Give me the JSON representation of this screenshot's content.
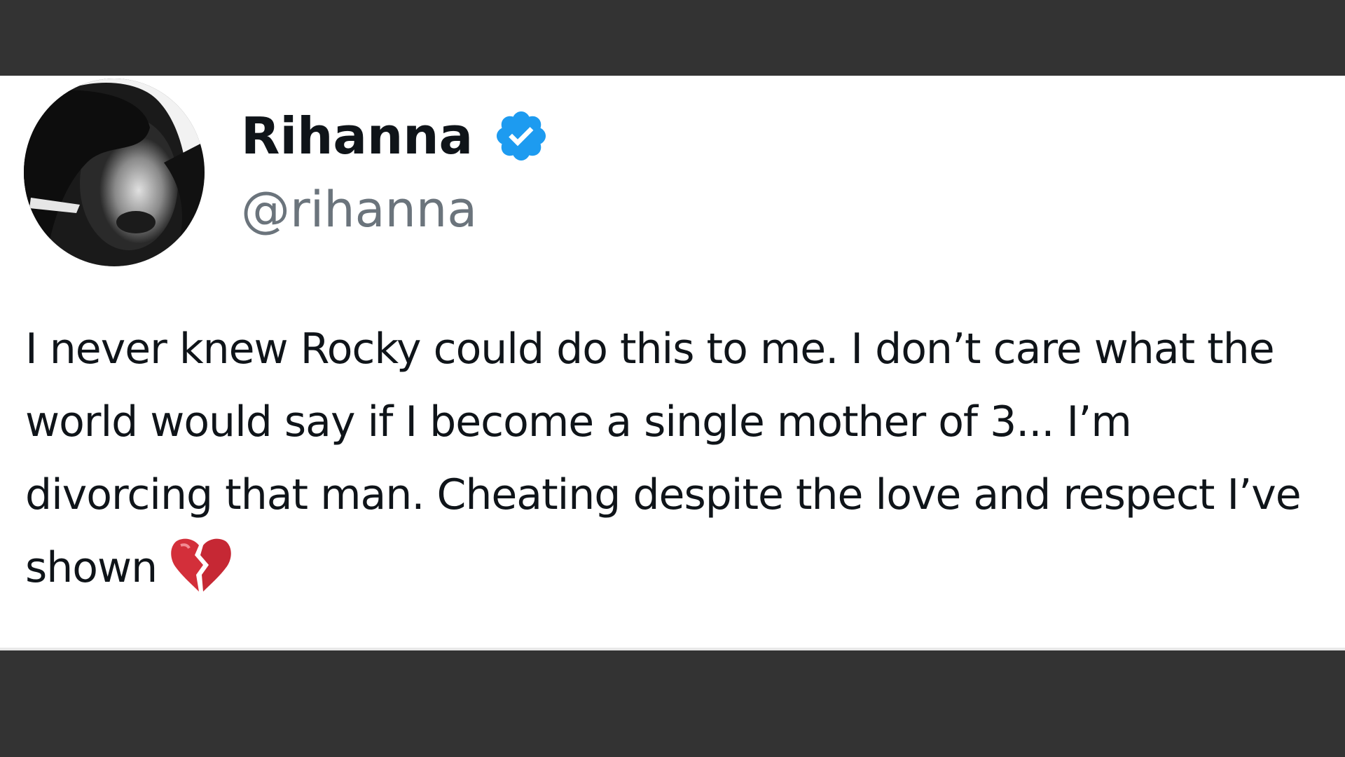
{
  "tweet": {
    "display_name": "Rihanna",
    "handle": "@rihanna",
    "verified_icon": "verified-badge-icon",
    "verified_color": "#1d9bf0",
    "text": "I never knew Rocky could do this to me. I don’t care what the world would say if I become a single mother of 3... I’m divorcing that man. Cheating despite the love and respect I’ve shown",
    "emoji": "broken-heart-icon",
    "emoji_color": "#d32f3a"
  }
}
